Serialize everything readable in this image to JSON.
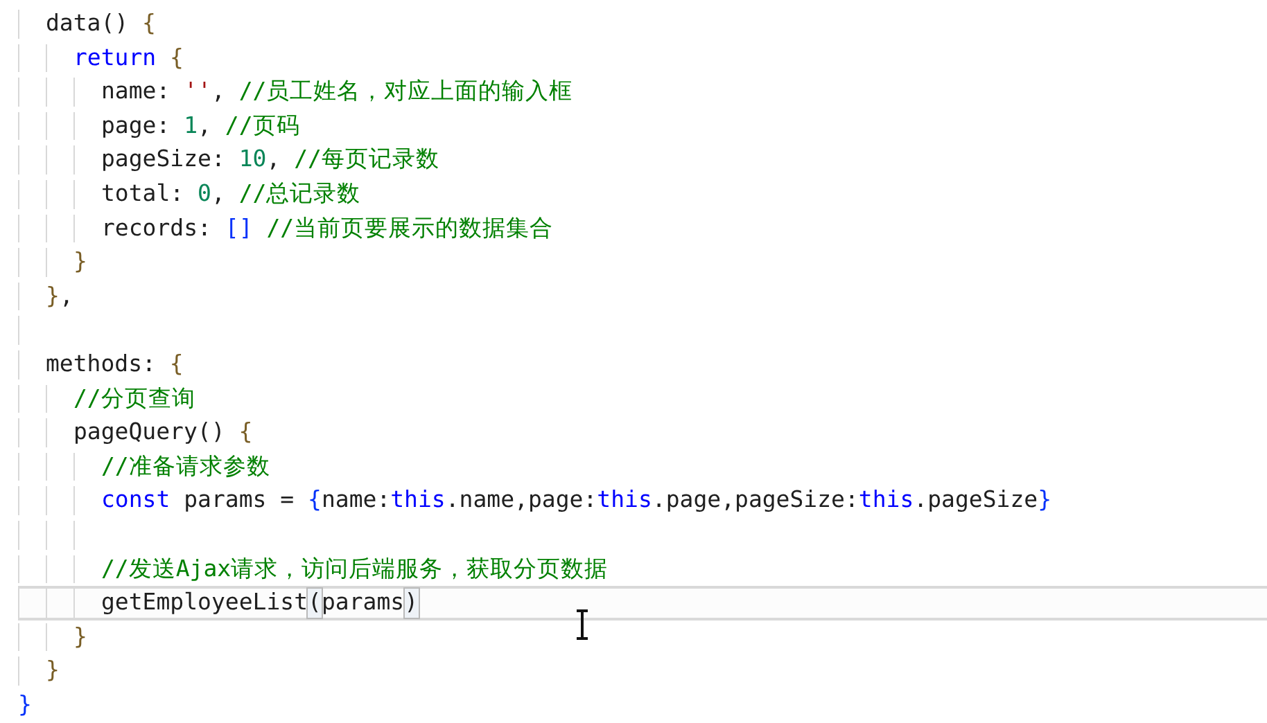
{
  "editor": {
    "lines": [
      {
        "current": false,
        "tokens": [
          {
            "text": "  data() ",
            "kind": "plain"
          },
          {
            "text": "{",
            "kind": "bracket"
          }
        ]
      },
      {
        "current": false,
        "tokens": [
          {
            "text": "    return",
            "kind": "keyword"
          },
          {
            "text": " {",
            "kind": "bracket"
          }
        ]
      },
      {
        "current": false,
        "tokens": [
          {
            "text": "      name: ",
            "kind": "plain"
          },
          {
            "text": "''",
            "kind": "string"
          },
          {
            "text": ", ",
            "kind": "plain"
          },
          {
            "text": "//员工姓名，对应上面的输入框",
            "kind": "comment"
          }
        ]
      },
      {
        "current": false,
        "tokens": [
          {
            "text": "      page: ",
            "kind": "plain"
          },
          {
            "text": "1",
            "kind": "number"
          },
          {
            "text": ", ",
            "kind": "plain"
          },
          {
            "text": "//页码",
            "kind": "comment"
          }
        ]
      },
      {
        "current": false,
        "tokens": [
          {
            "text": "      pageSize: ",
            "kind": "plain"
          },
          {
            "text": "10",
            "kind": "number"
          },
          {
            "text": ", ",
            "kind": "plain"
          },
          {
            "text": "//每页记录数",
            "kind": "comment"
          }
        ]
      },
      {
        "current": false,
        "tokens": [
          {
            "text": "      total: ",
            "kind": "plain"
          },
          {
            "text": "0",
            "kind": "number"
          },
          {
            "text": ", ",
            "kind": "plain"
          },
          {
            "text": "//总记录数",
            "kind": "comment"
          }
        ]
      },
      {
        "current": false,
        "tokens": [
          {
            "text": "      records: ",
            "kind": "plain"
          },
          {
            "text": "[]",
            "kind": "bracket2"
          },
          {
            "text": " //当前页要展示的数据集合",
            "kind": "comment"
          }
        ]
      },
      {
        "current": false,
        "tokens": [
          {
            "text": "    }",
            "kind": "bracket"
          }
        ]
      },
      {
        "current": false,
        "tokens": [
          {
            "text": "  }",
            "kind": "bracket"
          },
          {
            "text": ",",
            "kind": "plain"
          }
        ]
      },
      {
        "current": false
      },
      {
        "current": false,
        "tokens": [
          {
            "text": "  methods: ",
            "kind": "plain"
          },
          {
            "text": "{",
            "kind": "bracket"
          }
        ]
      },
      {
        "current": false,
        "tokens": [
          {
            "text": "    //分页查询",
            "kind": "comment"
          }
        ]
      },
      {
        "current": false,
        "tokens": [
          {
            "text": "    pageQuery() ",
            "kind": "plain"
          },
          {
            "text": "{",
            "kind": "bracket"
          }
        ]
      },
      {
        "current": false,
        "tokens": [
          {
            "text": "      //准备请求参数",
            "kind": "comment"
          }
        ]
      },
      {
        "current": false,
        "tokens": [
          {
            "text": "      const",
            "kind": "keyword"
          },
          {
            "text": " params = ",
            "kind": "plain"
          },
          {
            "text": "{",
            "kind": "bracket2"
          },
          {
            "text": "name:",
            "kind": "plain"
          },
          {
            "text": "this",
            "kind": "keyword"
          },
          {
            "text": ".name,page:",
            "kind": "plain"
          },
          {
            "text": "this",
            "kind": "keyword"
          },
          {
            "text": ".page,pageSize:",
            "kind": "plain"
          },
          {
            "text": "this",
            "kind": "keyword"
          },
          {
            "text": ".pageSize",
            "kind": "plain"
          },
          {
            "text": "}",
            "kind": "bracket2"
          }
        ]
      },
      {
        "current": false
      },
      {
        "current": false,
        "tokens": [
          {
            "text": "      //发送Ajax请求，访问后端服务，获取分页数据",
            "kind": "comment"
          }
        ]
      },
      {
        "current": true,
        "tokens": [
          {
            "text": "      getEmployeeList",
            "kind": "plain"
          },
          {
            "text": "(",
            "kind": "matched"
          },
          {
            "text": "params",
            "kind": "plain"
          },
          {
            "text": ")",
            "kind": "matched"
          }
        ]
      },
      {
        "current": false,
        "tokens": [
          {
            "text": "    }",
            "kind": "bracket"
          }
        ]
      },
      {
        "current": false,
        "tokens": [
          {
            "text": "  }",
            "kind": "bracket"
          }
        ]
      },
      {
        "current": false,
        "tokens": [
          {
            "text": "}",
            "kind": "bracket2"
          }
        ]
      }
    ]
  }
}
